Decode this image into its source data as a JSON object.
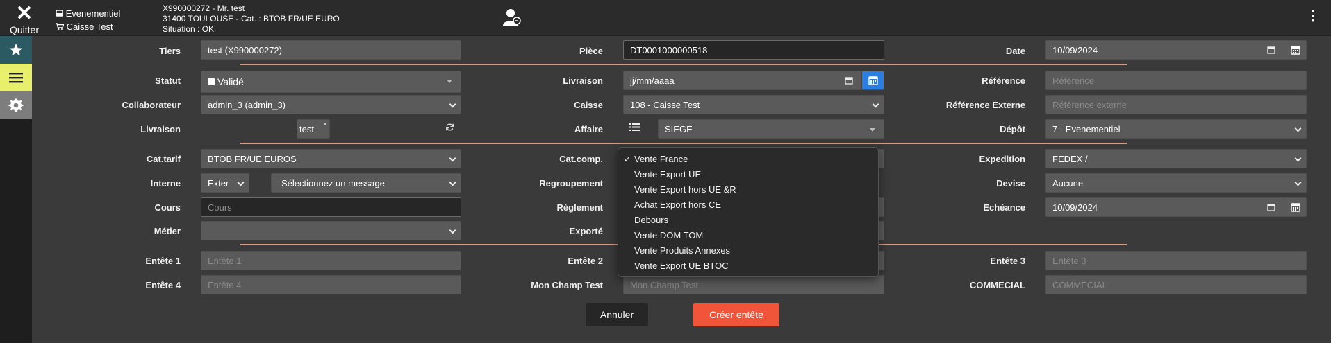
{
  "header": {
    "quit_label": "Quitter",
    "store_name": "Evenementiel",
    "register_name": "Caisse Test",
    "client_line1": "X990000272 - Mr. test",
    "client_line2": "31400 TOULOUSE - Cat. : BTOB FR/UE EURO",
    "client_line3": "Situation : OK"
  },
  "labels": {
    "tiers": "Tiers",
    "piece": "Pièce",
    "date": "Date",
    "statut": "Statut",
    "livraison": "Livraison",
    "reference": "Référence",
    "collaborateur": "Collaborateur",
    "caisse": "Caisse",
    "reference_externe": "Référence Externe",
    "livraison2": "Livraison",
    "affaire": "Affaire",
    "depot": "Dépôt",
    "cat_tarif": "Cat.tarif",
    "cat_comp": "Cat.comp.",
    "expedition": "Expedition",
    "interne": "Interne",
    "regroupement": "Regroupement",
    "devise": "Devise",
    "cours": "Cours",
    "reglement": "Règlement",
    "echeance": "Echéance",
    "metier": "Métier",
    "exporte": "Exporté",
    "entete1": "Entête 1",
    "entete2": "Entête 2",
    "entete3": "Entête 3",
    "entete4": "Entête 4",
    "mon_champ_test": "Mon Champ Test",
    "commercial": "COMMECIAL"
  },
  "fields": {
    "tiers": "test (X990000272)",
    "piece": "DT0001000000518",
    "date": "10/09/2024",
    "statut": "Validé",
    "livraison_date": "jj/mm/aaaa",
    "reference_ph": "Référence",
    "collaborateur": "admin_3 (admin_3)",
    "caisse": "108 - Caisse Test",
    "reference_externe_ph": "Référence externe",
    "livraison_select": "test -",
    "affaire": "SIEGE",
    "depot": "7 - Evenementiel",
    "cat_tarif": "BTOB FR/UE EUROS",
    "expedition": "FEDEX /",
    "interne": "Exter",
    "interne_message": "Sélectionnez un message",
    "devise": "Aucune",
    "cours_ph": "Cours",
    "echeance": "10/09/2024",
    "metier": "",
    "entete1_ph": "Entête 1",
    "entete3_ph": "Entête 3",
    "entete4_ph": "Entête 4",
    "mon_champ_test_ph": "Mon Champ Test",
    "commercial_ph": "COMMECIAL"
  },
  "cat_comp_dropdown": {
    "selected_mark": "✓",
    "options": [
      "Vente France",
      "Vente Export UE",
      "Vente Export hors UE &R",
      "Achat Export hors CE",
      "Debours",
      "Vente DOM TOM",
      "Vente Produits Annexes",
      "Vente Export UE BTOC"
    ]
  },
  "buttons": {
    "cancel": "Annuler",
    "create": "Créer entête"
  },
  "colors": {
    "accent": "#f0553a",
    "separator": "#d89a83",
    "calendar_active": "#2a7de1"
  }
}
